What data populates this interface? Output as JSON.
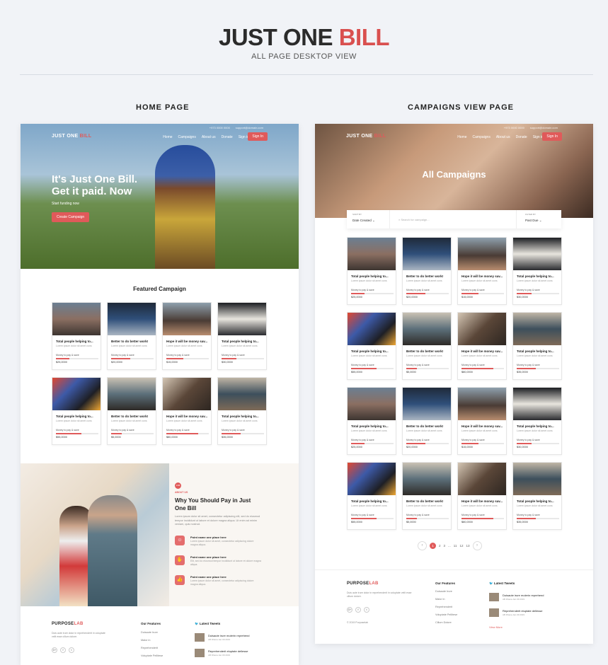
{
  "header": {
    "title_main": "JUST ONE ",
    "title_accent": "BILL",
    "subtitle": "ALL PAGE DESKTOP VIEW"
  },
  "sections": {
    "home_label": "HOME PAGE",
    "campaigns_label": "CAMPAIGNS VIEW PAGE"
  },
  "nav": {
    "logo_main": "JUST ONE ",
    "logo_accent": "BILL",
    "phone": "+973 0000 0000",
    "email": "support@domain.com",
    "links": [
      "Home",
      "Campaigns",
      "About us",
      "Donate",
      "Sign in"
    ],
    "signin": "Sign In"
  },
  "home": {
    "hero_line1": "It's Just One Bill.",
    "hero_line2": "Get it paid. Now",
    "hero_tag": "Start funding now",
    "hero_cta": "Create Campaign",
    "featured_title": "Featured Campaign",
    "about_badge": "JOB",
    "about_kicker": "ABOUT US",
    "about_title": "Why You Should Pay in Just One Bill",
    "about_lead": "Lorem ipsum dolor sit amet, consectetur adipiscing elit, sed do eiusmod tempor incididunt ut labore et dolore magna aliqua. Ut enim ad minim veniam, quis nostrud.",
    "points": [
      {
        "icon": "☺",
        "title": "Point name one place here",
        "desc": "Lorem ipsum dolor sit amet, consectetur adipiscing dolore magna aliqua."
      },
      {
        "icon": "✋",
        "title": "Point name one place here",
        "desc": "Elit, sed do eiusmod tempor incididunt ut labore et dolore magna aliqua."
      },
      {
        "icon": "👍",
        "title": "Point name one place here",
        "desc": "Lorem ipsum dolor sit amet, consectetur adipiscing dolore magna aliqua."
      }
    ]
  },
  "campaigns_page": {
    "hero_title": "All Campaigns",
    "sort_label": "SORT BY",
    "sort_value": "Date Created",
    "search_placeholder": "Search for campaign...",
    "filter_label": "FILTER BY",
    "filter_value": "Past Due",
    "pages": [
      "1",
      "2",
      "3",
      "...",
      "11",
      "12",
      "13"
    ]
  },
  "cards": [
    {
      "title": "Total people helping to...",
      "desc": "Lorem ipsum dolor sit amet cons",
      "money": "Money to pay & save",
      "value": "$25,0000",
      "progress": 0.32
    },
    {
      "title": "Better to do better work!",
      "desc": "Lorem ipsum dolor sit amet cons",
      "money": "Money to pay & save",
      "value": "$20,0000",
      "progress": 0.45
    },
    {
      "title": "Hope it will be money sav...",
      "desc": "Lorem ipsum dolor sit amet cons",
      "money": "Money to pay & save",
      "value": "$15,0000",
      "progress": 0.4
    },
    {
      "title": "Total people helping to...",
      "desc": "Lorem ipsum dolor sit amet cons",
      "money": "Money to pay & save",
      "value": "$30,0000",
      "progress": 0.35
    },
    {
      "title": "Total people helping to...",
      "desc": "Lorem ipsum dolor sit amet cons",
      "money": "Money to pay & save",
      "value": "$55,0000",
      "progress": 0.6
    },
    {
      "title": "Better to do better work!",
      "desc": "Lorem ipsum dolor sit amet cons",
      "money": "Money to pay & save",
      "value": "$5,0000",
      "progress": 0.25
    },
    {
      "title": "Hope it will be money sav...",
      "desc": "Lorem ipsum dolor sit amet cons",
      "money": "Money to pay & save",
      "value": "$80,0000",
      "progress": 0.75
    },
    {
      "title": "Total people helping to...",
      "desc": "Lorem ipsum dolor sit amet cons",
      "money": "Money to pay & save",
      "value": "$35,0000",
      "progress": 0.45
    }
  ],
  "footer": {
    "logo_main": "PURPOSE",
    "logo_accent": "LAB",
    "about": "Duis aute irure dolor in reprehenderit in voluptate velit esse cillum dolore.",
    "social": [
      "G+",
      "f",
      "t"
    ],
    "features_title": "Our Features",
    "features": [
      "Duisaute Irure",
      "Malor in",
      "Reprehenderit",
      "Voluptate Pellitese",
      "Cillum Dolore"
    ],
    "tweets_title": "Latest Tweets",
    "tweets": [
      {
        "text": "Duisaute irure molerin reprehend",
        "date": "AB Dhana  Jan 09 2019"
      },
      {
        "text": "Reprehenderit eluptate dellesse",
        "date": "AB Dhana  Jan 09 2019"
      }
    ],
    "view_more": "View More",
    "copyright": "© 2019 Purposelab"
  },
  "colors": {
    "accent": "#e05a5a",
    "background": "#f1f3f7"
  }
}
